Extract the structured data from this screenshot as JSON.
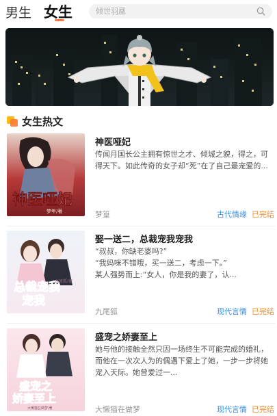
{
  "header": {
    "tabs": [
      {
        "label": "男生",
        "active": false
      },
      {
        "label": "女生",
        "active": true
      }
    ],
    "search_placeholder": "倾世羽凰",
    "accent_color": "#ff7a45"
  },
  "banner": {
    "icon": "anime-character-illustration"
  },
  "section": {
    "title": "女生热文",
    "icon": "hot-section-icon"
  },
  "books": [
    {
      "title": "神医哑妃",
      "description": "传闻月国长公主拥有惊世之才、倾城之貌，得之，可得天下。如此传奇的女子却“死”在了自己最宠爱的...",
      "author": "梦篁",
      "genre": "古代情缘",
      "status": "已完结",
      "cover_text": "神医哑妃",
      "cover_sub": "梦年/著"
    },
    {
      "title": "娶一送二，总裁宠我宠我",
      "description": "“叔叔，你缺老婆吗?”\n“我妈咪不错哦，买一送二，考虑一下。”\n某人强势而上:“女人，你是我的妻了，认...",
      "author": "九尾狐",
      "genre": "现代言情",
      "status": "已完结",
      "cover_text_1": "总裁宠我",
      "cover_text_2": "宠我",
      "cover_sub": "九尾狐/著"
    },
    {
      "title": "盛宠之娇妻至上",
      "description": "她与他的接触全然只因一场终生不可能完成的婚礼，而他在一次次人为的偶遇下爱上了她，一步一步将她宠入天际。她曾爱过一...",
      "author": "大懒猫在做梦",
      "genre": "现代言情",
      "status": "已完结",
      "cover_text_1": "盛宠之",
      "cover_text_2": "娇妻至上",
      "cover_sub": "大懒猫在做梦/著"
    }
  ],
  "colors": {
    "genre": "#3a8de0",
    "status": "#f08a2a"
  }
}
